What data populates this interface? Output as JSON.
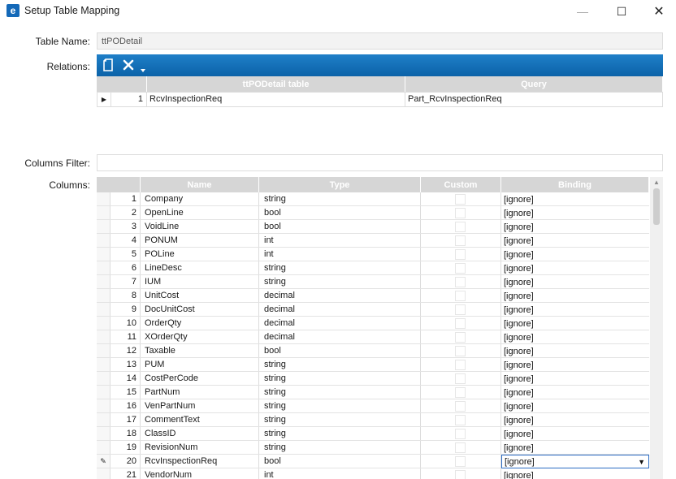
{
  "window": {
    "title": "Setup Table Mapping",
    "app_icon_letter": "e",
    "minimize_glyph": "—",
    "maximize_glyph": "☐",
    "close_glyph": "✕"
  },
  "form": {
    "table_name_label": "Table Name:",
    "table_name_value": "ttPODetail",
    "relations_label": "Relations:",
    "columns_filter_label": "Columns Filter:",
    "columns_filter_value": "",
    "columns_label": "Columns:"
  },
  "relations": {
    "toolbar": {
      "new_icon": "new-document-icon",
      "delete_icon": "delete-x-icon",
      "more_icon": "dropdown-caret-icon"
    },
    "headers": [
      "ttPODetail table",
      "Query"
    ],
    "rows": [
      {
        "indicator": "▶",
        "num": "1",
        "table": "RcvInspectionReq",
        "query": "Part_RcvInspectionReq"
      }
    ]
  },
  "columns": {
    "headers": {
      "name": "Name",
      "type": "Type",
      "custom": "Custom",
      "binding": "Binding"
    },
    "edit_indicator": "✎",
    "rows": [
      {
        "num": "1",
        "name": "Company",
        "type": "string",
        "binding": "[ignore]"
      },
      {
        "num": "2",
        "name": "OpenLine",
        "type": "bool",
        "binding": "[ignore]"
      },
      {
        "num": "3",
        "name": "VoidLine",
        "type": "bool",
        "binding": "[ignore]"
      },
      {
        "num": "4",
        "name": "PONUM",
        "type": "int",
        "binding": "[ignore]"
      },
      {
        "num": "5",
        "name": "POLine",
        "type": "int",
        "binding": "[ignore]"
      },
      {
        "num": "6",
        "name": "LineDesc",
        "type": "string",
        "binding": "[ignore]"
      },
      {
        "num": "7",
        "name": "IUM",
        "type": "string",
        "binding": "[ignore]"
      },
      {
        "num": "8",
        "name": "UnitCost",
        "type": "decimal",
        "binding": "[ignore]"
      },
      {
        "num": "9",
        "name": "DocUnitCost",
        "type": "decimal",
        "binding": "[ignore]"
      },
      {
        "num": "10",
        "name": "OrderQty",
        "type": "decimal",
        "binding": "[ignore]"
      },
      {
        "num": "11",
        "name": "XOrderQty",
        "type": "decimal",
        "binding": "[ignore]"
      },
      {
        "num": "12",
        "name": "Taxable",
        "type": "bool",
        "binding": "[ignore]"
      },
      {
        "num": "13",
        "name": "PUM",
        "type": "string",
        "binding": "[ignore]"
      },
      {
        "num": "14",
        "name": "CostPerCode",
        "type": "string",
        "binding": "[ignore]"
      },
      {
        "num": "15",
        "name": "PartNum",
        "type": "string",
        "binding": "[ignore]"
      },
      {
        "num": "16",
        "name": "VenPartNum",
        "type": "string",
        "binding": "[ignore]"
      },
      {
        "num": "17",
        "name": "CommentText",
        "type": "string",
        "binding": "[ignore]"
      },
      {
        "num": "18",
        "name": "ClassID",
        "type": "string",
        "binding": "[ignore]"
      },
      {
        "num": "19",
        "name": "RevisionNum",
        "type": "string",
        "binding": "[ignore]"
      },
      {
        "num": "20",
        "name": "RcvInspectionReq",
        "type": "bool",
        "binding": "[ignore]",
        "editing": true
      },
      {
        "num": "21",
        "name": "VendorNum",
        "type": "int",
        "binding": "[ignore]"
      }
    ]
  },
  "colors": {
    "toolbar_blue": "#0b62a8",
    "header_gray": "#d6d6d6",
    "selection_border": "#2b6cc4"
  }
}
